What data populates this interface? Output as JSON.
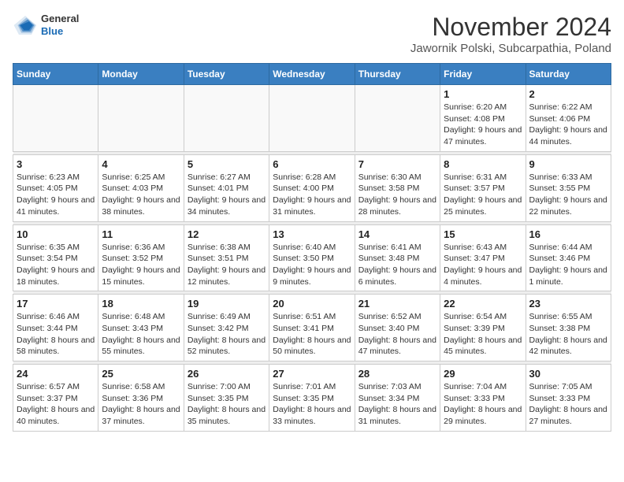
{
  "header": {
    "logo": {
      "general": "General",
      "blue": "Blue"
    },
    "title": "November 2024",
    "location": "Jawornik Polski, Subcarpathia, Poland"
  },
  "weekdays": [
    "Sunday",
    "Monday",
    "Tuesday",
    "Wednesday",
    "Thursday",
    "Friday",
    "Saturday"
  ],
  "weeks": [
    [
      {
        "day": "",
        "info": ""
      },
      {
        "day": "",
        "info": ""
      },
      {
        "day": "",
        "info": ""
      },
      {
        "day": "",
        "info": ""
      },
      {
        "day": "",
        "info": ""
      },
      {
        "day": "1",
        "info": "Sunrise: 6:20 AM\nSunset: 4:08 PM\nDaylight: 9 hours and 47 minutes."
      },
      {
        "day": "2",
        "info": "Sunrise: 6:22 AM\nSunset: 4:06 PM\nDaylight: 9 hours and 44 minutes."
      }
    ],
    [
      {
        "day": "3",
        "info": "Sunrise: 6:23 AM\nSunset: 4:05 PM\nDaylight: 9 hours and 41 minutes."
      },
      {
        "day": "4",
        "info": "Sunrise: 6:25 AM\nSunset: 4:03 PM\nDaylight: 9 hours and 38 minutes."
      },
      {
        "day": "5",
        "info": "Sunrise: 6:27 AM\nSunset: 4:01 PM\nDaylight: 9 hours and 34 minutes."
      },
      {
        "day": "6",
        "info": "Sunrise: 6:28 AM\nSunset: 4:00 PM\nDaylight: 9 hours and 31 minutes."
      },
      {
        "day": "7",
        "info": "Sunrise: 6:30 AM\nSunset: 3:58 PM\nDaylight: 9 hours and 28 minutes."
      },
      {
        "day": "8",
        "info": "Sunrise: 6:31 AM\nSunset: 3:57 PM\nDaylight: 9 hours and 25 minutes."
      },
      {
        "day": "9",
        "info": "Sunrise: 6:33 AM\nSunset: 3:55 PM\nDaylight: 9 hours and 22 minutes."
      }
    ],
    [
      {
        "day": "10",
        "info": "Sunrise: 6:35 AM\nSunset: 3:54 PM\nDaylight: 9 hours and 18 minutes."
      },
      {
        "day": "11",
        "info": "Sunrise: 6:36 AM\nSunset: 3:52 PM\nDaylight: 9 hours and 15 minutes."
      },
      {
        "day": "12",
        "info": "Sunrise: 6:38 AM\nSunset: 3:51 PM\nDaylight: 9 hours and 12 minutes."
      },
      {
        "day": "13",
        "info": "Sunrise: 6:40 AM\nSunset: 3:50 PM\nDaylight: 9 hours and 9 minutes."
      },
      {
        "day": "14",
        "info": "Sunrise: 6:41 AM\nSunset: 3:48 PM\nDaylight: 9 hours and 6 minutes."
      },
      {
        "day": "15",
        "info": "Sunrise: 6:43 AM\nSunset: 3:47 PM\nDaylight: 9 hours and 4 minutes."
      },
      {
        "day": "16",
        "info": "Sunrise: 6:44 AM\nSunset: 3:46 PM\nDaylight: 9 hours and 1 minute."
      }
    ],
    [
      {
        "day": "17",
        "info": "Sunrise: 6:46 AM\nSunset: 3:44 PM\nDaylight: 8 hours and 58 minutes."
      },
      {
        "day": "18",
        "info": "Sunrise: 6:48 AM\nSunset: 3:43 PM\nDaylight: 8 hours and 55 minutes."
      },
      {
        "day": "19",
        "info": "Sunrise: 6:49 AM\nSunset: 3:42 PM\nDaylight: 8 hours and 52 minutes."
      },
      {
        "day": "20",
        "info": "Sunrise: 6:51 AM\nSunset: 3:41 PM\nDaylight: 8 hours and 50 minutes."
      },
      {
        "day": "21",
        "info": "Sunrise: 6:52 AM\nSunset: 3:40 PM\nDaylight: 8 hours and 47 minutes."
      },
      {
        "day": "22",
        "info": "Sunrise: 6:54 AM\nSunset: 3:39 PM\nDaylight: 8 hours and 45 minutes."
      },
      {
        "day": "23",
        "info": "Sunrise: 6:55 AM\nSunset: 3:38 PM\nDaylight: 8 hours and 42 minutes."
      }
    ],
    [
      {
        "day": "24",
        "info": "Sunrise: 6:57 AM\nSunset: 3:37 PM\nDaylight: 8 hours and 40 minutes."
      },
      {
        "day": "25",
        "info": "Sunrise: 6:58 AM\nSunset: 3:36 PM\nDaylight: 8 hours and 37 minutes."
      },
      {
        "day": "26",
        "info": "Sunrise: 7:00 AM\nSunset: 3:35 PM\nDaylight: 8 hours and 35 minutes."
      },
      {
        "day": "27",
        "info": "Sunrise: 7:01 AM\nSunset: 3:35 PM\nDaylight: 8 hours and 33 minutes."
      },
      {
        "day": "28",
        "info": "Sunrise: 7:03 AM\nSunset: 3:34 PM\nDaylight: 8 hours and 31 minutes."
      },
      {
        "day": "29",
        "info": "Sunrise: 7:04 AM\nSunset: 3:33 PM\nDaylight: 8 hours and 29 minutes."
      },
      {
        "day": "30",
        "info": "Sunrise: 7:05 AM\nSunset: 3:33 PM\nDaylight: 8 hours and 27 minutes."
      }
    ]
  ]
}
